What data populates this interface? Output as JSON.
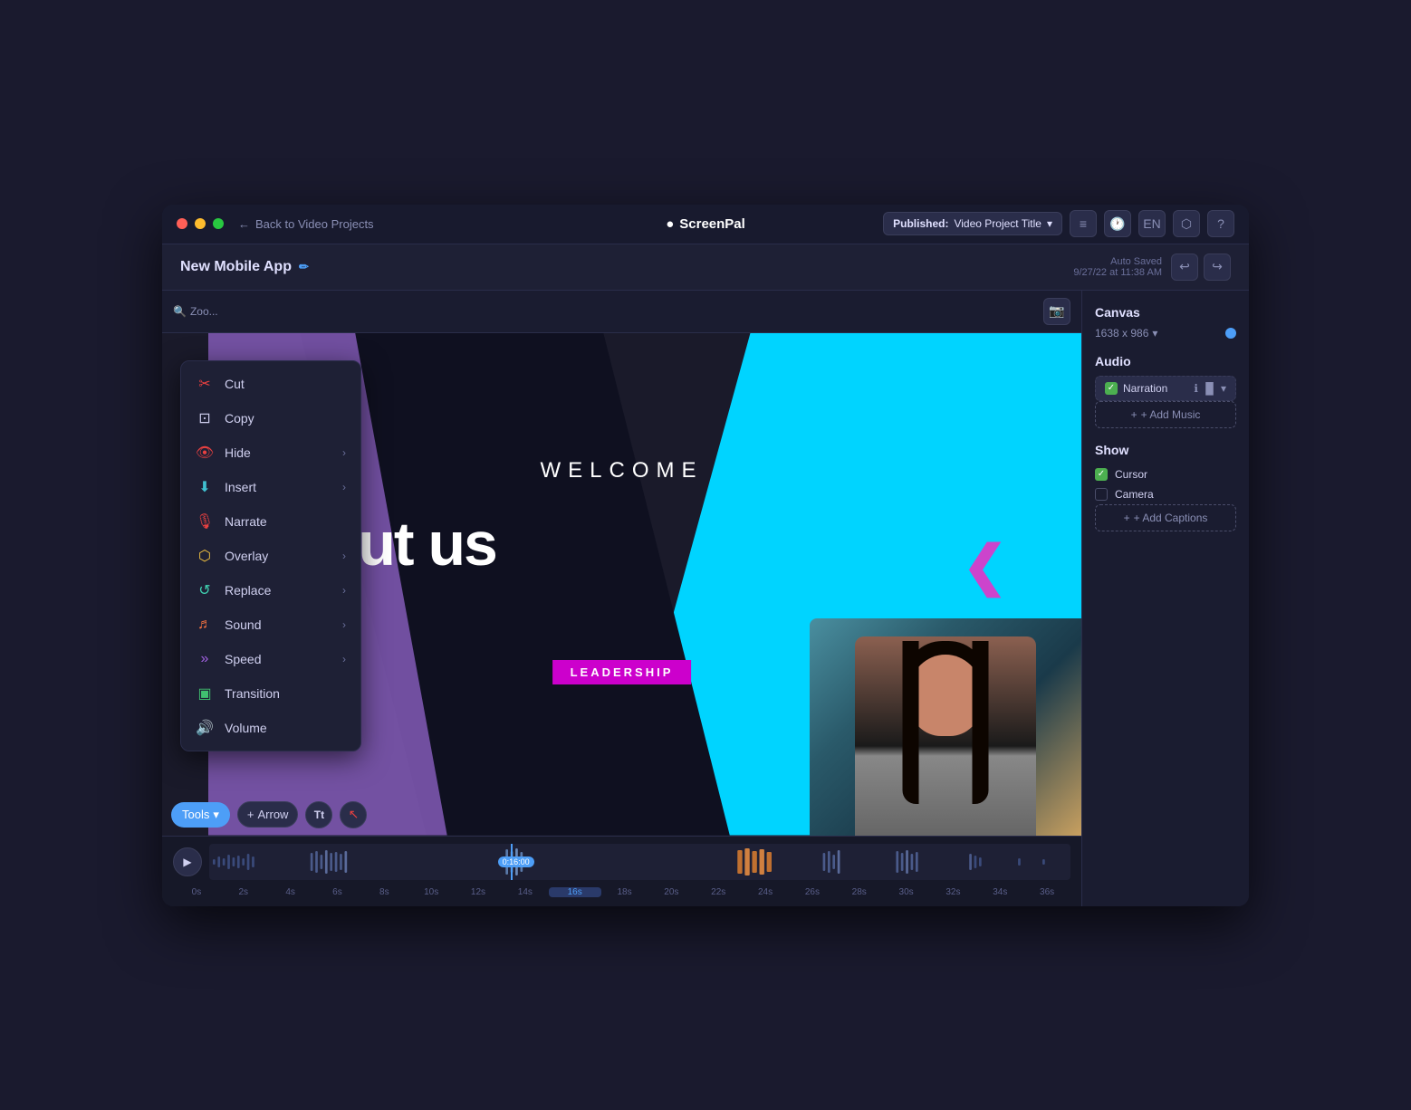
{
  "titleBar": {
    "back_label": "Back to Video Projects",
    "logo": "ScreenPal",
    "publish_prefix": "Published:",
    "publish_title": "Video Project Title",
    "icons": [
      "list-icon",
      "clock-icon",
      "lang-icon",
      "layers-icon",
      "help-icon"
    ],
    "lang_label": "EN"
  },
  "editorHeader": {
    "project_title": "New Mobile App",
    "auto_saved_label": "Auto Saved",
    "auto_saved_date": "9/27/22 at 11:38 AM"
  },
  "contextMenu": {
    "items": [
      {
        "id": "cut",
        "label": "Cut",
        "icon": "✂",
        "icon_class": "icon-red",
        "has_arrow": false
      },
      {
        "id": "copy",
        "label": "Copy",
        "icon": "⊡",
        "icon_class": "",
        "has_arrow": false
      },
      {
        "id": "hide",
        "label": "Hide",
        "icon": "👁",
        "icon_class": "icon-red",
        "has_arrow": true
      },
      {
        "id": "insert",
        "label": "Insert",
        "icon": "⬇",
        "icon_class": "icon-cyan",
        "has_arrow": true
      },
      {
        "id": "narrate",
        "label": "Narrate",
        "icon": "🎙",
        "icon_class": "icon-red",
        "has_arrow": false
      },
      {
        "id": "overlay",
        "label": "Overlay",
        "icon": "⬡",
        "icon_class": "icon-yellow",
        "has_arrow": true
      },
      {
        "id": "replace",
        "label": "Replace",
        "icon": "↺",
        "icon_class": "icon-teal",
        "has_arrow": true
      },
      {
        "id": "sound",
        "label": "Sound",
        "icon": "♬",
        "icon_class": "icon-orange",
        "has_arrow": true
      },
      {
        "id": "speed",
        "label": "Speed",
        "icon": "»",
        "icon_class": "icon-purple",
        "has_arrow": true
      },
      {
        "id": "transition",
        "label": "Transition",
        "icon": "▣",
        "icon_class": "icon-green",
        "has_arrow": false
      },
      {
        "id": "volume",
        "label": "Volume",
        "icon": "🔊",
        "icon_class": "icon-purple",
        "has_arrow": false
      }
    ]
  },
  "videoCanvas": {
    "welcome_text": "WELCOME",
    "about_us_text": "about us",
    "leadership_text": "LEADERSHIP"
  },
  "bottomToolbar": {
    "tools_label": "Tools",
    "arrow_label": "Arrow",
    "tt_label": "Tt",
    "cursor_label": "↖"
  },
  "rightPanel": {
    "canvas_section": "Canvas",
    "canvas_size": "1638 x 986",
    "audio_section": "Audio",
    "narration_label": "Narration",
    "add_music_label": "+ Add Music",
    "show_section": "Show",
    "cursor_label": "Cursor",
    "camera_label": "Camera",
    "add_captions_label": "+ Add Captions"
  },
  "timeline": {
    "playhead_time": "0:16:00",
    "markers": [
      "0s",
      "2s",
      "4s",
      "6s",
      "8s",
      "10s",
      "12s",
      "14s",
      "16s",
      "18s",
      "20s",
      "22s",
      "24s",
      "26s",
      "28s",
      "30s",
      "32s",
      "34s",
      "36s"
    ]
  }
}
